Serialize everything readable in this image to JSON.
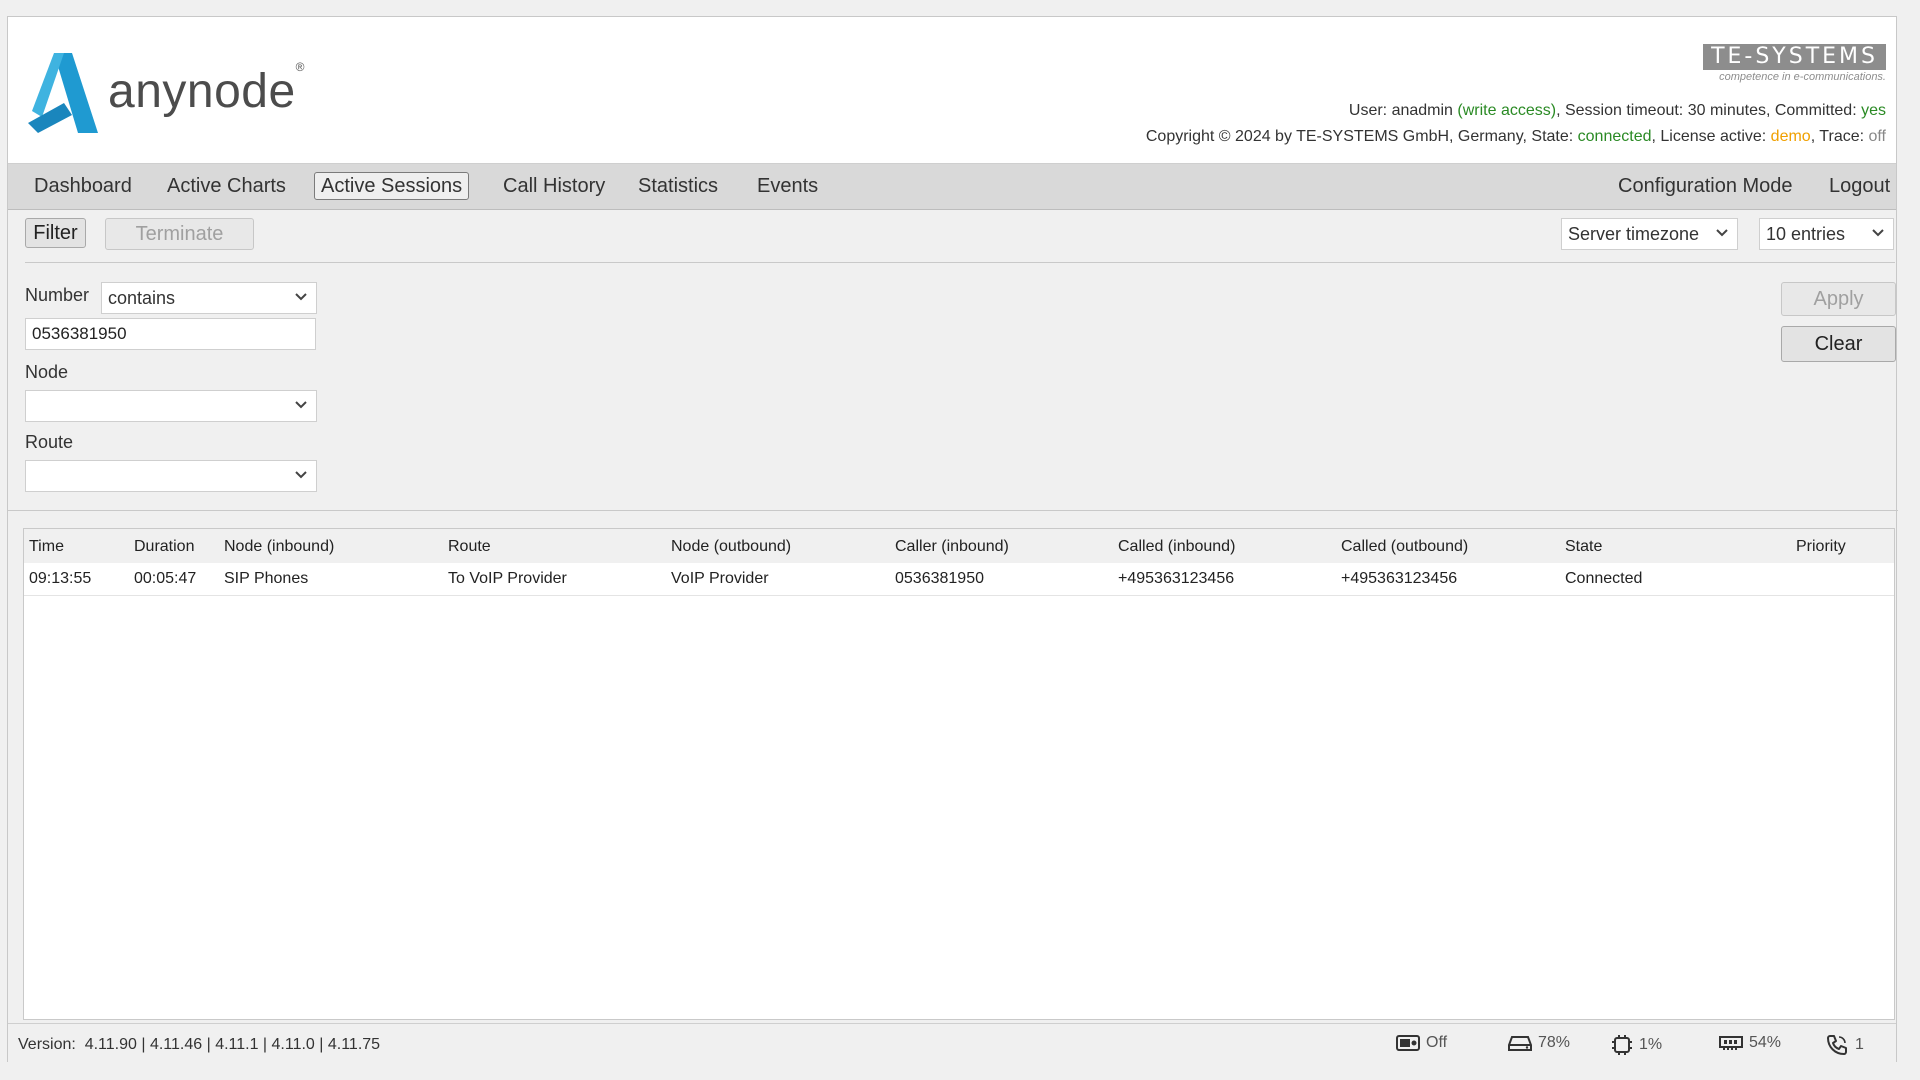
{
  "header": {
    "logo_text": "anynode",
    "logo_reg": "®",
    "brand_name": "TE-SYSTEMS",
    "brand_tagline": "competence in e-communications.",
    "user_prefix": "User: ",
    "user_name": "anadmin",
    "user_access": "(write access)",
    "session_text": ", Session timeout: 30 minutes, Committed: ",
    "committed": "yes",
    "copyright_text": "Copyright © 2024 by TE-SYSTEMS GmbH, Germany, State: ",
    "state": "connected",
    "license_text": ", License active: ",
    "license": "demo",
    "trace_text": ", Trace: ",
    "trace": "off"
  },
  "nav": {
    "items": [
      "Dashboard",
      "Active Charts",
      "Active Sessions",
      "Call History",
      "Statistics",
      "Events"
    ],
    "right": [
      "Configuration Mode",
      "Logout"
    ]
  },
  "toolbar": {
    "filter_label": "Filter",
    "terminate_label": "Terminate",
    "timezone_value": "Server timezone",
    "entries_value": "10 entries"
  },
  "filter": {
    "number_label": "Number",
    "number_mode": "contains",
    "number_value": "0536381950",
    "node_label": "Node",
    "node_value": "",
    "route_label": "Route",
    "route_value": "",
    "apply_label": "Apply",
    "clear_label": "Clear"
  },
  "table": {
    "columns": [
      "Time",
      "Duration",
      "Node (inbound)",
      "Route",
      "Node (outbound)",
      "Caller (inbound)",
      "Called (inbound)",
      "Called (outbound)",
      "State",
      "Priority"
    ],
    "rows": [
      [
        "09:13:55",
        "00:05:47",
        "SIP Phones",
        "To VoIP Provider",
        "VoIP Provider",
        "0536381950",
        "+495363123456",
        "+495363123456",
        "Connected",
        ""
      ]
    ]
  },
  "footer": {
    "version_label": "Version:",
    "versions": "4.11.90 | 4.11.46 | 4.11.1 | 4.11.0 | 4.11.75",
    "recording": "Off",
    "disk": "78%",
    "cpu": "1%",
    "memory": "54%",
    "sessions": "1"
  },
  "colors": {
    "logo_blue": "#1f9ad1",
    "ok_green": "#2a8a24",
    "warn_orange": "#f0a000"
  }
}
